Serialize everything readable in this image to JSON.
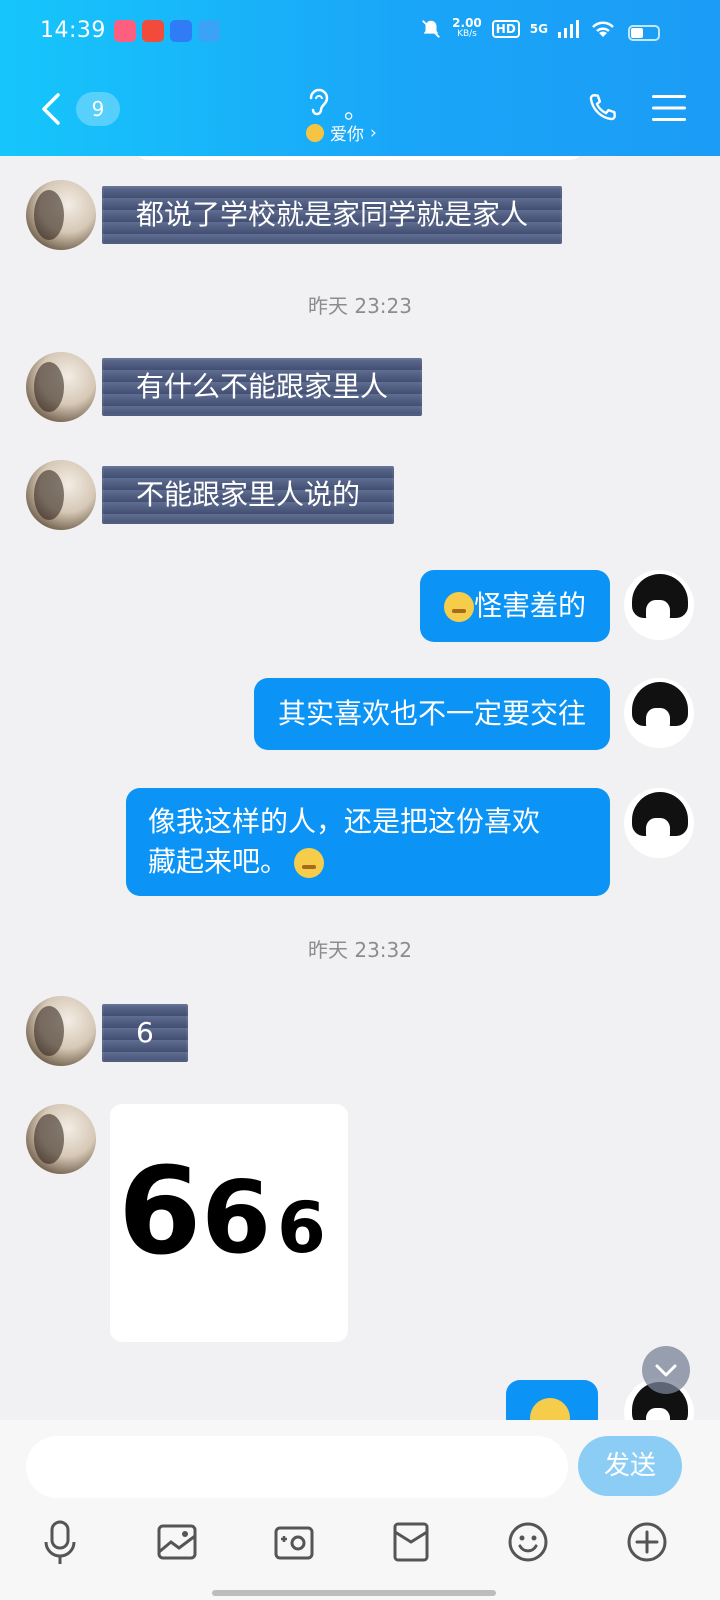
{
  "status_bar": {
    "time": "14:39",
    "net_speed_value": "2.00",
    "net_speed_unit": "KB/s",
    "hd_label": "HD",
    "network_label": "5G",
    "icons": [
      "app-icon-1",
      "app-icon-2",
      "app-icon-3",
      "app-icon-4",
      "mute-bell-icon",
      "signal-icon",
      "wifi-icon",
      "battery-icon"
    ]
  },
  "header": {
    "unread_count": "9",
    "contact_name": "。",
    "subtitle": "爱你",
    "subtitle_arrow": "›",
    "icons": [
      "back-arrow-icon",
      "ear-icon",
      "phone-icon",
      "menu-icon"
    ]
  },
  "messages": [
    {
      "side": "in",
      "text": "都说了学校就是家同学就是家人"
    },
    {
      "type": "timestamp",
      "text": "昨天 23:23"
    },
    {
      "side": "in",
      "text": "有什么不能跟家里人"
    },
    {
      "side": "in",
      "text": "不能跟家里人说的"
    },
    {
      "side": "out",
      "emoji": "shy-emoji",
      "text": "怪害羞的"
    },
    {
      "side": "out",
      "text": "其实喜欢也不一定要交往"
    },
    {
      "side": "out",
      "text": "像我这样的人，还是把这份喜欢\n藏起来吧。",
      "emoji": "smile-emoji"
    },
    {
      "type": "timestamp",
      "text": "昨天 23:32"
    },
    {
      "side": "in",
      "text": "6"
    },
    {
      "side": "in",
      "type": "sticker",
      "sticker_chars": [
        "6",
        "6",
        "6"
      ]
    }
  ],
  "input": {
    "value": "",
    "send_label": "发送"
  },
  "toolbar": [
    "mic-icon",
    "image-icon",
    "camera-icon",
    "wallet-icon",
    "emoji-icon",
    "plus-icon"
  ],
  "colors": {
    "header_gradient_start": "#16c6fb",
    "header_gradient_end": "#1b9cf6",
    "outgoing_bubble": "#0b94f6",
    "incoming_bubble": "#505d80",
    "send_button": "#8ccdf6",
    "background": "#f1f1f3"
  }
}
